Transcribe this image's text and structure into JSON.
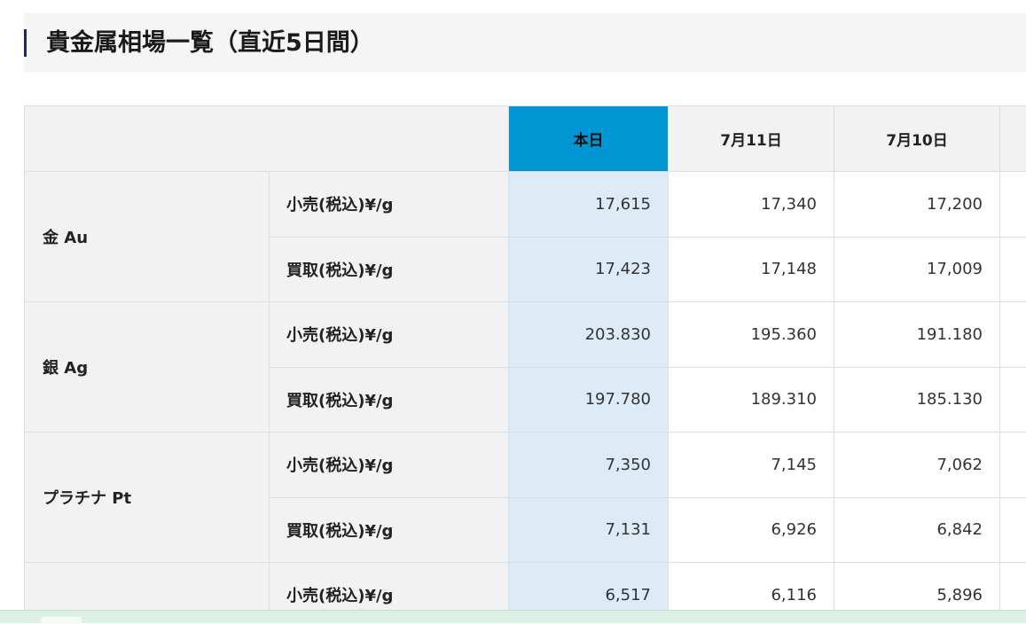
{
  "title": "貴金属相場一覧（直近5日間）",
  "columns": [
    "本日",
    "7月11日",
    "7月10日"
  ],
  "colors": {
    "today_header": "#0096d6",
    "today_cell": "#ddebf6",
    "label_bg": "#f2f2f2",
    "title_accent": "#1b2a5e"
  },
  "metals": [
    {
      "name": "金 Au",
      "rows": [
        {
          "type": "小売(税込)¥/g",
          "values": [
            "17,615",
            "17,340",
            "17,200"
          ]
        },
        {
          "type": "買取(税込)¥/g",
          "values": [
            "17,423",
            "17,148",
            "17,009"
          ]
        }
      ]
    },
    {
      "name": "銀 Ag",
      "rows": [
        {
          "type": "小売(税込)¥/g",
          "values": [
            "203.830",
            "195.360",
            "191.180"
          ]
        },
        {
          "type": "買取(税込)¥/g",
          "values": [
            "197.780",
            "189.310",
            "185.130"
          ]
        }
      ]
    },
    {
      "name": "プラチナ Pt",
      "rows": [
        {
          "type": "小売(税込)¥/g",
          "values": [
            "7,350",
            "7,145",
            "7,062"
          ]
        },
        {
          "type": "買取(税込)¥/g",
          "values": [
            "7,131",
            "6,926",
            "6,842"
          ]
        }
      ]
    },
    {
      "name": "",
      "rows": [
        {
          "type": "小売(税込)¥/g",
          "values": [
            "6,517",
            "6,116",
            "5,896"
          ]
        }
      ]
    }
  ]
}
